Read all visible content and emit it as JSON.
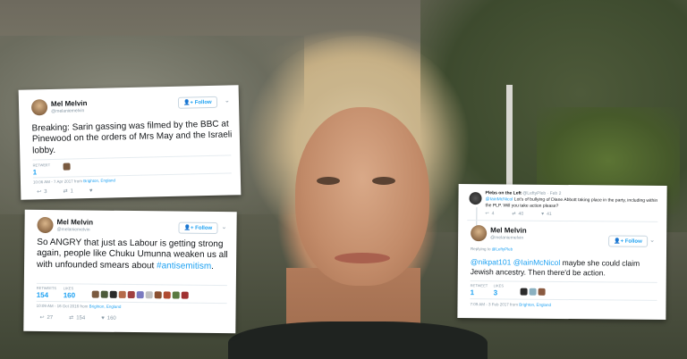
{
  "tweets": [
    {
      "author_name": "Mel Melvin",
      "author_handle": "@melaniemelvin",
      "follow_label": "Follow",
      "text": "Breaking: Sarin gassing was filmed by the BBC at Pinewood on the orders of Mrs May and the Israeli lobby.",
      "retweets_label": "RETWEET",
      "retweets": "1",
      "timestamp": "10:06 AM - 7 Apr 2017 from",
      "location": "Brighton, England",
      "reply_count": "3",
      "retweet_count": "1",
      "like_count": ""
    },
    {
      "author_name": "Mel Melvin",
      "author_handle": "@melaniemelvin",
      "follow_label": "Follow",
      "text_before": "So ANGRY that just as Labour is getting strong again, people like Chuku Umunna weaken us all with unfounded smears about ",
      "hashtag": "#antisemitism",
      "text_after": ".",
      "retweets_label": "RETWEETS",
      "retweets": "154",
      "likes_label": "LIKES",
      "likes": "160",
      "timestamp": "10:09 AM - 16 Oct 2016 from",
      "location": "Brighton, England",
      "reply_count": "27",
      "retweet_count": "154",
      "like_count": "160"
    },
    {
      "parent_author": "Plebs on the Left",
      "parent_handle": "@LeftyPleb · Feb 2",
      "parent_mention": "@IainMcNicol",
      "parent_text": " Lot's of bullying of Diane Abbott taking place in the party, including within the PLP. Will you take action please?",
      "parent_reply_count": "4",
      "parent_retweet_count": "40",
      "parent_like_count": "41",
      "author_name": "Mel Melvin",
      "author_handle": "@melaniemelvin",
      "follow_label": "Follow",
      "replying_to_label": "Replying to",
      "replying_to_handle": "@LeftyPleb",
      "mention1": "@nikpat101",
      "mention2": "@IainMcNicol",
      "text": " maybe she could claim Jewish ancestry. Then there'd be action.",
      "retweets_label": "RETWEET",
      "retweets": "1",
      "likes_label": "LIKES",
      "likes": "3",
      "timestamp": "7:09 AM - 3 Feb 2017 from",
      "location": "Brighton, England"
    }
  ]
}
